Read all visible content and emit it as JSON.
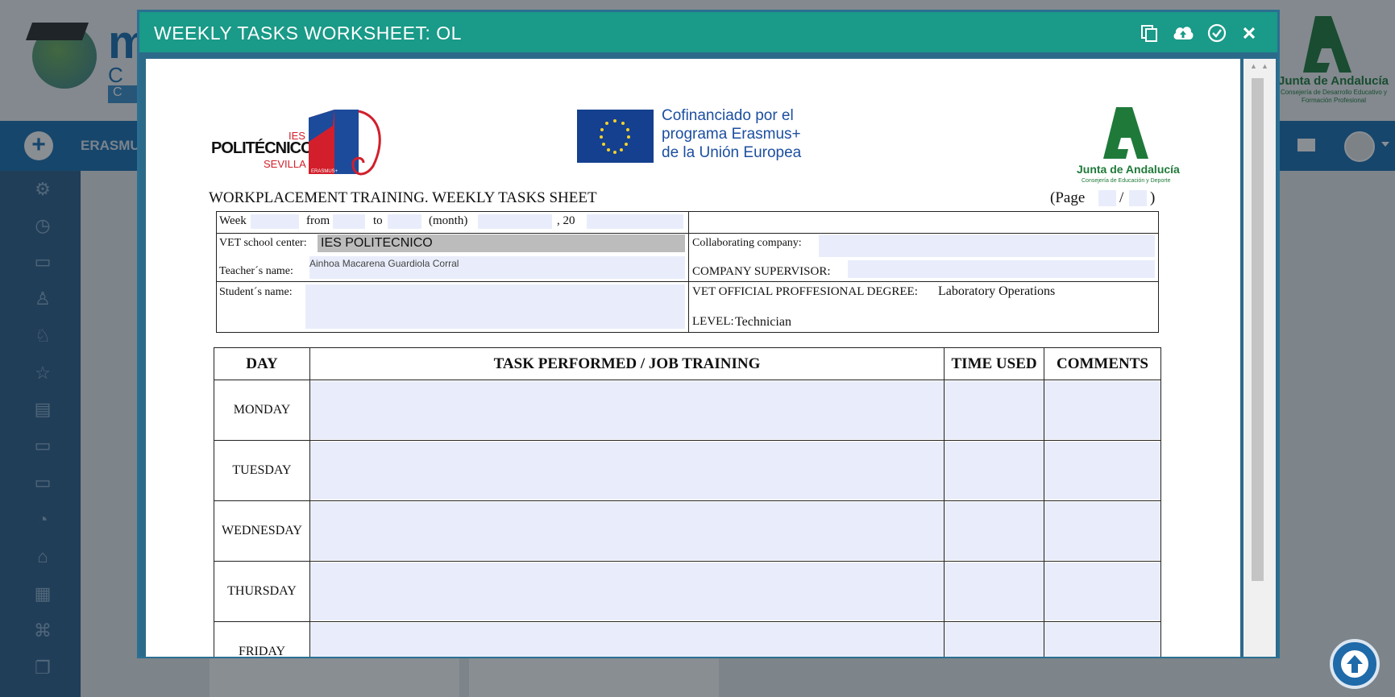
{
  "background": {
    "nav_label": "ERASMU",
    "right_logo": {
      "name": "Junta de Andalucía",
      "subtitle": "Consejería de Desarrollo Educativo y Formación Profesional"
    }
  },
  "modal": {
    "title": "WEEKLY TASKS WORKSHEET: OL",
    "tools": [
      "copy-icon",
      "cloud-upload-icon",
      "check-circle-icon",
      "close-icon"
    ]
  },
  "document": {
    "ies_logo": {
      "top": "IES",
      "main": "POLITÉCNICO",
      "bottom": "SEVILLA",
      "badge": "ERASMUS+"
    },
    "erasmus_caption": [
      "Cofinanciado por el",
      "programa Erasmus+",
      "de la Unión Europea"
    ],
    "junta_logo": {
      "name": "Junta de Andalucía",
      "subtitle": "Consejería de Educación y Deporte"
    },
    "heading": "WORKPLACEMENT TRAINING. WEEKLY TASKS SHEET",
    "page_label": "(Page",
    "page_sep": "/",
    "page_close": ")",
    "header_rows": {
      "week": "Week",
      "from": "from",
      "to": "to",
      "month": "(month)",
      "year_prefix": ", 20",
      "vet_school_label": "VET school center:",
      "vet_school_value": "IES POLITECNICO",
      "collab_label": "Collaborating company:",
      "teacher_label": "Teacher´s name:",
      "teacher_value": "Ainhoa Macarena Guardiola Corral",
      "supervisor_label": "COMPANY SUPERVISOR:",
      "student_label": "Student´s name:",
      "degree_label": "VET OFFICIAL PROFFESIONAL DEGREE:",
      "degree_value": "Laboratory Operations",
      "level_label": "LEVEL:",
      "level_value": "Technician"
    },
    "task_table": {
      "headers": [
        "DAY",
        "TASK PERFORMED / JOB TRAINING",
        "TIME USED",
        "COMMENTS"
      ],
      "days": [
        "MONDAY",
        "TUESDAY",
        "WEDNESDAY",
        "THURSDAY",
        "FRIDAY"
      ]
    }
  }
}
